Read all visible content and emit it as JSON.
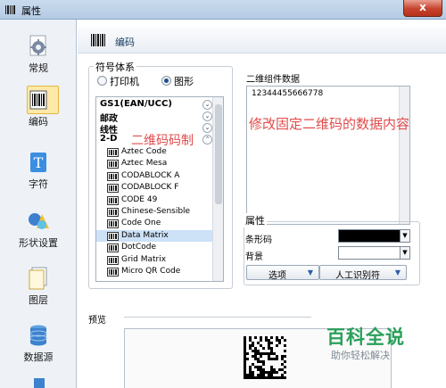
{
  "window": {
    "title": "属性",
    "close_label": "x"
  },
  "nav": {
    "items": [
      {
        "label": "常规",
        "icon": "gear-icon"
      },
      {
        "label": "编码",
        "icon": "barcode-icon",
        "active": true
      },
      {
        "label": "字符",
        "icon": "text-icon"
      },
      {
        "label": "形状设置",
        "icon": "shapes-icon"
      },
      {
        "label": "图层",
        "icon": "layer-icon"
      },
      {
        "label": "数据源",
        "icon": "database-icon"
      }
    ]
  },
  "header": {
    "title": "编码"
  },
  "symbology": {
    "group_label": "符号体系",
    "radio_printer": "打印机",
    "radio_graphic": "图形",
    "selected_radio": "图形",
    "categories": [
      "GS1(EAN/UCC)",
      "邮政",
      "线性",
      "2-D"
    ],
    "items": [
      "Aztec Code",
      "Aztec Mesa",
      "CODABLOCK A",
      "CODABLOCK F",
      "CODE 49",
      "Chinese-Sensible",
      "Code One",
      "Data Matrix",
      "DotCode",
      "Grid Matrix",
      "Micro QR Code"
    ],
    "selected_item": "Data Matrix"
  },
  "annotations": {
    "list_note": "二维码码制",
    "data_note": "修改固定二维码的数据内容"
  },
  "data_field": {
    "label": "二维组件数据",
    "value": "12344455666778"
  },
  "properties": {
    "group_label": "属性",
    "bar_color_label": "条形码",
    "bg_label": "背景",
    "bar_color": "#000000",
    "bg_color": "#ffffff",
    "options_button": "选项",
    "hri_button": "人工识别符"
  },
  "preview": {
    "label": "预览"
  },
  "watermark": {
    "title": "百科全说",
    "subtitle": "助你轻松解决"
  }
}
